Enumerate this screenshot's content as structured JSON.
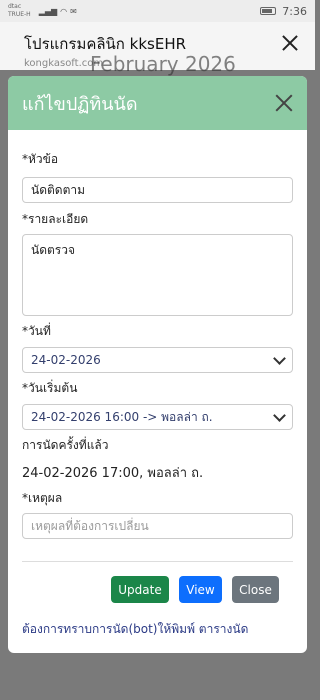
{
  "status_bar": {
    "carrier_line1": "dtac",
    "carrier_line2": "TRUE-H",
    "time": "7:36"
  },
  "browser_header": {
    "title": "โปรแกรมคลินิก kksEHR",
    "domain": "kongkasoft.com",
    "background_text": "February 2026"
  },
  "modal": {
    "title": "แก้ไขปฏิทินนัด",
    "subject_label": "*หัวข้อ",
    "subject_value": "นัดติดตาม",
    "details_label": "*รายละเอียด",
    "details_value": "นัดตรวจ",
    "date_label": "*วันที่",
    "date_value": "24-02-2026",
    "start_label": "*วันเริ่มต้น",
    "start_value": "24-02-2026 16:00 -> พอลล่า ถ.",
    "previous_label": "การนัดครั้งที่แล้ว",
    "previous_value": "24-02-2026 17:00, พอลล่า ถ.",
    "reason_label": "*เหตุผล",
    "reason_placeholder": "เหตุผลที่ต้องการเปลี่ยน",
    "buttons": {
      "update": "Update",
      "view": "View",
      "close": "Close"
    },
    "bottom_link": "ต้องการทราบการนัด(bot)ให้พิมพ์ ตารางนัด"
  },
  "colors": {
    "modal_header": "#8dcaa4",
    "update": "#1b8649",
    "view": "#0d6efd",
    "close": "#6c757d"
  }
}
